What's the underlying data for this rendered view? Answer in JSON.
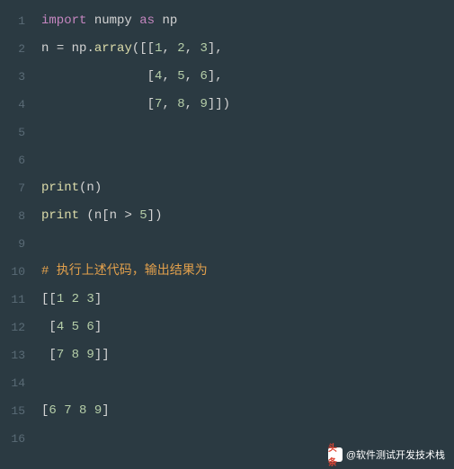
{
  "lines": [
    {
      "num": "1",
      "tokens": [
        {
          "cls": "tk-keyword",
          "t": "import"
        },
        {
          "cls": "tk-default",
          "t": " numpy "
        },
        {
          "cls": "tk-keyword",
          "t": "as"
        },
        {
          "cls": "tk-default",
          "t": " np"
        }
      ]
    },
    {
      "num": "2",
      "tokens": [
        {
          "cls": "tk-ident",
          "t": "n "
        },
        {
          "cls": "tk-op",
          "t": "="
        },
        {
          "cls": "tk-ident",
          "t": " np"
        },
        {
          "cls": "tk-punct",
          "t": "."
        },
        {
          "cls": "tk-func",
          "t": "array"
        },
        {
          "cls": "tk-punct",
          "t": "([["
        },
        {
          "cls": "tk-num",
          "t": "1"
        },
        {
          "cls": "tk-punct",
          "t": ", "
        },
        {
          "cls": "tk-num",
          "t": "2"
        },
        {
          "cls": "tk-punct",
          "t": ", "
        },
        {
          "cls": "tk-num",
          "t": "3"
        },
        {
          "cls": "tk-punct",
          "t": "],"
        }
      ]
    },
    {
      "num": "3",
      "tokens": [
        {
          "cls": "tk-default",
          "t": "              "
        },
        {
          "cls": "tk-punct",
          "t": "["
        },
        {
          "cls": "tk-num",
          "t": "4"
        },
        {
          "cls": "tk-punct",
          "t": ", "
        },
        {
          "cls": "tk-num",
          "t": "5"
        },
        {
          "cls": "tk-punct",
          "t": ", "
        },
        {
          "cls": "tk-num",
          "t": "6"
        },
        {
          "cls": "tk-punct",
          "t": "],"
        }
      ]
    },
    {
      "num": "4",
      "tokens": [
        {
          "cls": "tk-default",
          "t": "              "
        },
        {
          "cls": "tk-punct",
          "t": "["
        },
        {
          "cls": "tk-num",
          "t": "7"
        },
        {
          "cls": "tk-punct",
          "t": ", "
        },
        {
          "cls": "tk-num",
          "t": "8"
        },
        {
          "cls": "tk-punct",
          "t": ", "
        },
        {
          "cls": "tk-num",
          "t": "9"
        },
        {
          "cls": "tk-punct",
          "t": "]])"
        }
      ]
    },
    {
      "num": "5",
      "tokens": []
    },
    {
      "num": "6",
      "tokens": []
    },
    {
      "num": "7",
      "tokens": [
        {
          "cls": "tk-func",
          "t": "print"
        },
        {
          "cls": "tk-punct",
          "t": "("
        },
        {
          "cls": "tk-ident",
          "t": "n"
        },
        {
          "cls": "tk-punct",
          "t": ")"
        }
      ]
    },
    {
      "num": "8",
      "tokens": [
        {
          "cls": "tk-func",
          "t": "print"
        },
        {
          "cls": "tk-default",
          "t": " "
        },
        {
          "cls": "tk-punct",
          "t": "("
        },
        {
          "cls": "tk-ident",
          "t": "n"
        },
        {
          "cls": "tk-punct",
          "t": "["
        },
        {
          "cls": "tk-ident",
          "t": "n "
        },
        {
          "cls": "tk-op",
          "t": ">"
        },
        {
          "cls": "tk-default",
          "t": " "
        },
        {
          "cls": "tk-num",
          "t": "5"
        },
        {
          "cls": "tk-punct",
          "t": "])"
        }
      ]
    },
    {
      "num": "9",
      "tokens": []
    },
    {
      "num": "10",
      "tokens": [
        {
          "cls": "tk-comment",
          "t": "# 执行上述代码，输出结果为"
        }
      ]
    },
    {
      "num": "11",
      "tokens": [
        {
          "cls": "tk-punct",
          "t": "[["
        },
        {
          "cls": "tk-num",
          "t": "1 2 3"
        },
        {
          "cls": "tk-punct",
          "t": "]"
        }
      ]
    },
    {
      "num": "12",
      "tokens": [
        {
          "cls": "tk-default",
          "t": " "
        },
        {
          "cls": "tk-punct",
          "t": "["
        },
        {
          "cls": "tk-num",
          "t": "4 5 6"
        },
        {
          "cls": "tk-punct",
          "t": "]"
        }
      ]
    },
    {
      "num": "13",
      "tokens": [
        {
          "cls": "tk-default",
          "t": " "
        },
        {
          "cls": "tk-punct",
          "t": "["
        },
        {
          "cls": "tk-num",
          "t": "7 8 9"
        },
        {
          "cls": "tk-punct",
          "t": "]]"
        }
      ]
    },
    {
      "num": "14",
      "tokens": []
    },
    {
      "num": "15",
      "tokens": [
        {
          "cls": "tk-punct",
          "t": "["
        },
        {
          "cls": "tk-num",
          "t": "6 7 8 9"
        },
        {
          "cls": "tk-punct",
          "t": "]"
        }
      ]
    },
    {
      "num": "16",
      "tokens": []
    }
  ],
  "watermark": {
    "icon_text": "头条",
    "label": "@软件测试开发技术栈"
  }
}
